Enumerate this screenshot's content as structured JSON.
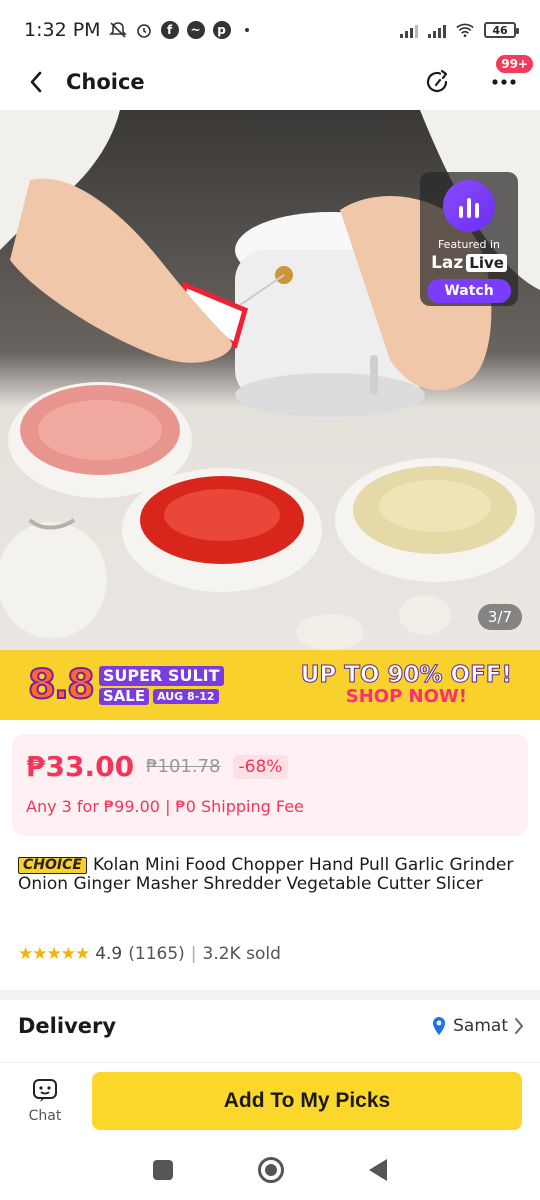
{
  "status_bar": {
    "time": "1:32 PM",
    "battery": "46",
    "icons": [
      "mute-icon",
      "alarm-icon",
      "facebook-icon",
      "messenger-icon",
      "pinterest-icon",
      "signal-icon",
      "signal-icon",
      "wifi-icon",
      "battery-icon"
    ]
  },
  "header": {
    "title": "Choice",
    "cart_badge": "99+"
  },
  "gallery": {
    "counter": "3/7",
    "live": {
      "featured": "Featured in",
      "brand_left": "Laz",
      "brand_right": "Live",
      "watch": "Watch"
    }
  },
  "banner": {
    "event": "8.8",
    "line1": "SUPER SULIT",
    "line2": "SALE",
    "dates": "AUG 8-12",
    "headline": "UP TO 90% OFF!",
    "cta": "SHOP NOW!",
    "colors": {
      "background": "#f8d12d",
      "accent": "#7a3cdf",
      "pink": "#ff2d78"
    }
  },
  "price": {
    "current": "₱33.00",
    "original": "₱101.78",
    "discount": "-68%",
    "promo": "Any 3 for ₱99.00 | ₱0 Shipping Fee",
    "color": "#f2355a"
  },
  "product": {
    "tag": "CHOICE",
    "title": "Kolan Mini Food Chopper Hand Pull Garlic Grinder Onion Ginger Masher Shredder Vegetable Cutter Slicer",
    "stars": "★★★★★",
    "rating": "4.9",
    "reviews": "(1165)",
    "separator": "|",
    "sold": "3.2K sold",
    "star_count": 5
  },
  "delivery": {
    "title": "Delivery",
    "location": "Samat"
  },
  "bottom_bar": {
    "chat_label": "Chat",
    "cta_label": "Add To My Picks",
    "cta_color": "#fbd72c"
  }
}
